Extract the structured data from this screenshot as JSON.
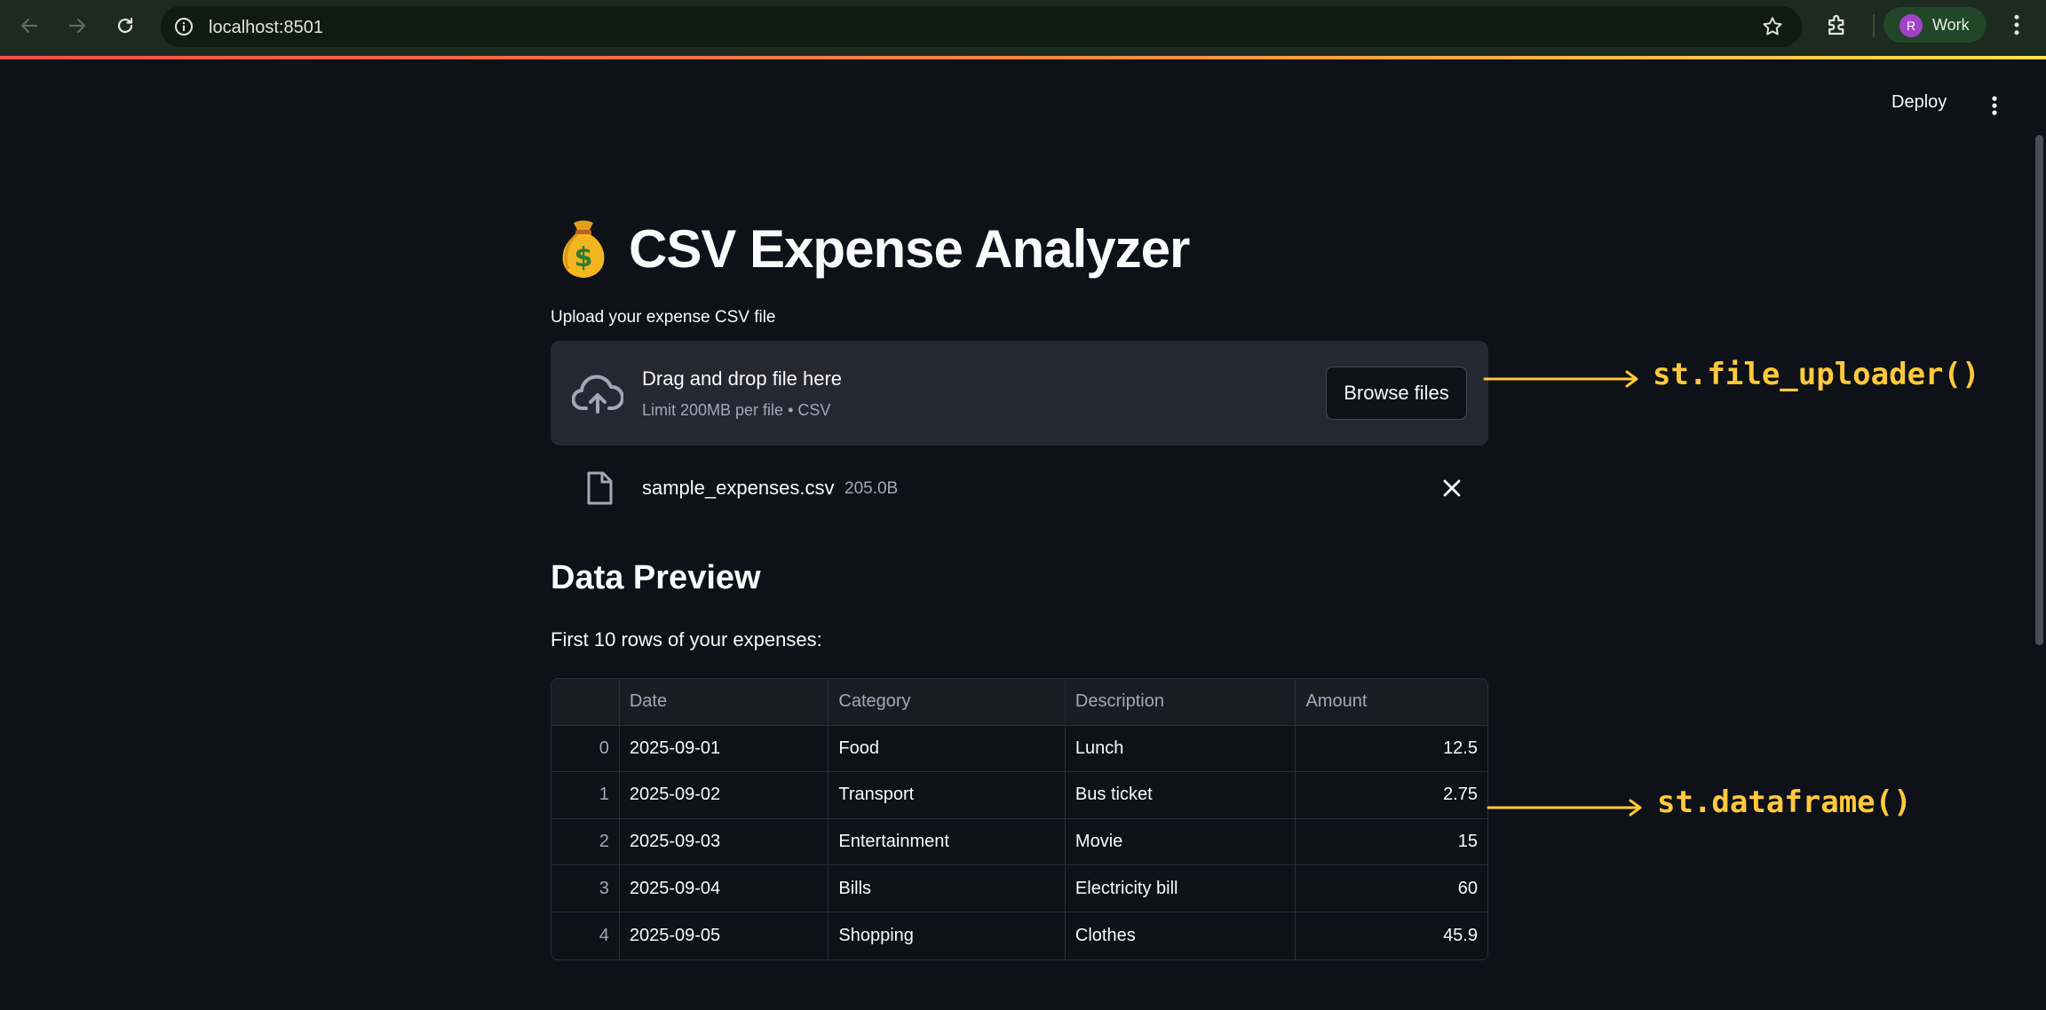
{
  "browser": {
    "url": "localhost:8501",
    "profile_initial": "R",
    "profile_name": "Work",
    "accent_gradient": [
      "#ff4b4b",
      "#ff8a3d",
      "#ffe14b"
    ]
  },
  "app_header": {
    "deploy_label": "Deploy"
  },
  "main": {
    "title": "CSV Expense Analyzer",
    "title_icon": "money-bag-icon",
    "uploader": {
      "label": "Upload your expense CSV file",
      "drop_text": "Drag and drop file here",
      "limit_text": "Limit 200MB per file • CSV",
      "browse_label": "Browse files"
    },
    "uploaded_file": {
      "name": "sample_expenses.csv",
      "size": "205.0B"
    },
    "section_title": "Data Preview",
    "section_subtitle": "First 10 rows of your expenses:",
    "table": {
      "columns": [
        "",
        "Date",
        "Category",
        "Description",
        "Amount"
      ],
      "rows": [
        [
          "0",
          "2025-09-01",
          "Food",
          "Lunch",
          "12.5"
        ],
        [
          "1",
          "2025-09-02",
          "Transport",
          "Bus ticket",
          "2.75"
        ],
        [
          "2",
          "2025-09-03",
          "Entertainment",
          "Movie",
          "15"
        ],
        [
          "3",
          "2025-09-04",
          "Bills",
          "Electricity bill",
          "60"
        ],
        [
          "4",
          "2025-09-05",
          "Shopping",
          "Clothes",
          "45.9"
        ]
      ]
    }
  },
  "annotations": {
    "uploader": "st.file_uploader()",
    "dataframe": "st.dataframe()",
    "color": "#ffc93c"
  }
}
